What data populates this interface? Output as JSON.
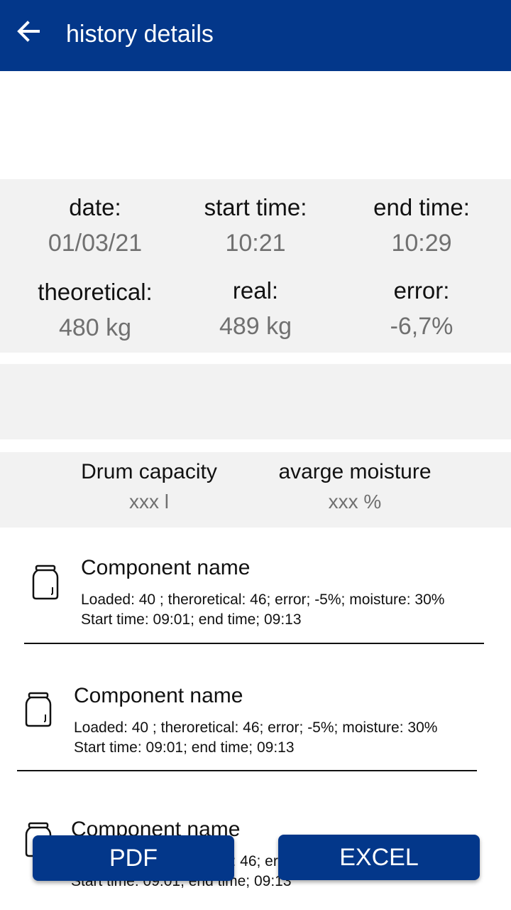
{
  "header": {
    "title": "history details",
    "back_icon": "arrow-left-icon"
  },
  "summary": {
    "date_label": "date:",
    "date_value": "01/03/21",
    "start_label": "start time:",
    "start_value": "10:21",
    "end_label": "end time:",
    "end_value": "10:29",
    "theoretical_label": "theoretical:",
    "theoretical_value": "480 kg",
    "real_label": "real:",
    "real_value": "489 kg",
    "error_label": "error:",
    "error_value": "-6,7%"
  },
  "drum": {
    "capacity_label": "Drum capacity",
    "capacity_value": "xxx l",
    "moisture_label": "avarge moisture",
    "moisture_value": "xxx %"
  },
  "components": [
    {
      "name": "Component name",
      "line1": "Loaded: 40 ; theroretical: 46; error; -5%; moisture: 30%",
      "line2": "Start time: 09:01; end time; 09:13",
      "icon": "jar-icon"
    },
    {
      "name": "Component name",
      "line1": "Loaded: 40 ; theroretical: 46; error; -5%; moisture: 30%",
      "line2": "Start time: 09:01; end time; 09:13",
      "icon": "jar-icon"
    },
    {
      "name": "Component name",
      "line1": "Loaded: 40 ; theroretical: 46; error; -5%; moisture: 30%",
      "line2": "Start time: 09:01; end time; 09:13",
      "icon": "jar-icon"
    }
  ],
  "buttons": {
    "pdf_label": "PDF",
    "excel_label": "EXCEL"
  },
  "colors": {
    "primary": "#03378a",
    "panel": "#f2f2f2",
    "value_text": "#707070"
  }
}
